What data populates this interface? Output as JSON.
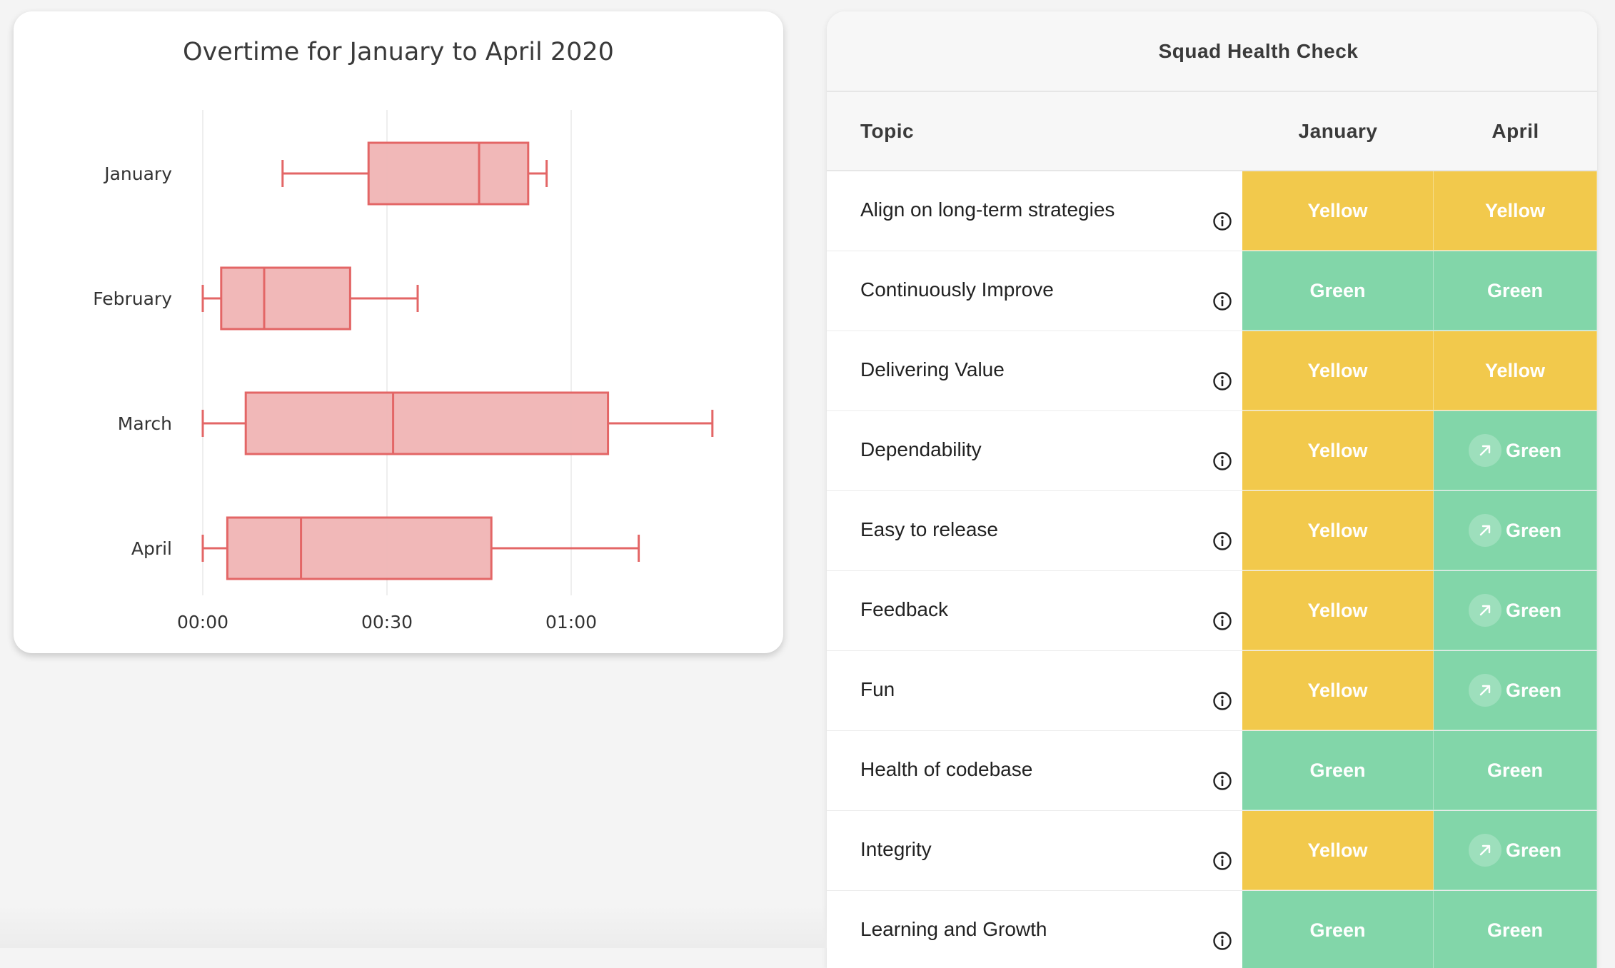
{
  "colors": {
    "box_fill": "#f0b4b4",
    "box_stroke": "#e36666",
    "yellow": "#f2c94c",
    "green": "#82d6a9"
  },
  "chart_data": {
    "type": "box",
    "orientation": "horizontal",
    "title": "Overtime for January to April 2020",
    "x_unit": "hh:mm",
    "xlim": [
      "00:00",
      "01:18"
    ],
    "x_ticks": [
      "00:00",
      "00:30",
      "01:00"
    ],
    "grid": "vertical",
    "legend": "none",
    "categories": [
      "January",
      "February",
      "March",
      "April"
    ],
    "boxes": [
      {
        "name": "January",
        "min": "00:13",
        "q1": "00:27",
        "median": "00:45",
        "q3": "00:53",
        "max": "00:56"
      },
      {
        "name": "February",
        "min": "00:00",
        "q1": "00:03",
        "median": "00:10",
        "q3": "00:24",
        "max": "00:35"
      },
      {
        "name": "March",
        "min": "00:00",
        "q1": "00:07",
        "median": "00:31",
        "q3": "01:06",
        "max": "01:23"
      },
      {
        "name": "April",
        "min": "00:00",
        "q1": "00:04",
        "median": "00:16",
        "q3": "00:47",
        "max": "01:11"
      }
    ]
  },
  "table": {
    "title": "Squad Health Check",
    "headers": {
      "topic": "Topic",
      "january": "January",
      "april": "April"
    },
    "rows": [
      {
        "topic": "Align on long-term strategies",
        "january": "Yellow",
        "april": "Yellow",
        "april_trend_up": false
      },
      {
        "topic": "Continuously Improve",
        "january": "Green",
        "april": "Green",
        "april_trend_up": false
      },
      {
        "topic": "Delivering Value",
        "january": "Yellow",
        "april": "Yellow",
        "april_trend_up": false
      },
      {
        "topic": "Dependability",
        "january": "Yellow",
        "april": "Green",
        "april_trend_up": true
      },
      {
        "topic": "Easy to release",
        "january": "Yellow",
        "april": "Green",
        "april_trend_up": true
      },
      {
        "topic": "Feedback",
        "january": "Yellow",
        "april": "Green",
        "april_trend_up": true
      },
      {
        "topic": "Fun",
        "january": "Yellow",
        "april": "Green",
        "april_trend_up": true
      },
      {
        "topic": "Health of codebase",
        "january": "Green",
        "april": "Green",
        "april_trend_up": false
      },
      {
        "topic": "Integrity",
        "january": "Yellow",
        "april": "Green",
        "april_trend_up": true
      },
      {
        "topic": "Learning and Growth",
        "january": "Green",
        "april": "Green",
        "april_trend_up": false
      }
    ]
  },
  "icons": {
    "info": "info-circle-icon",
    "trend": "arrow-up-right-icon"
  }
}
